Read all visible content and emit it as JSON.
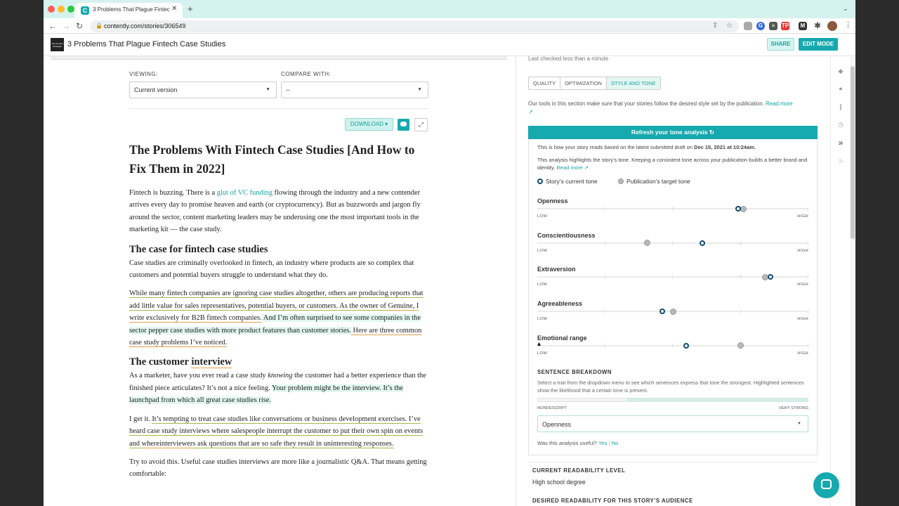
{
  "browser": {
    "tab_title": "3 Problems That Plague Fintech Case Studies",
    "tab_favicon": "C",
    "url": "contently.com/stories/306549",
    "extensions": [
      "G",
      "≡",
      "TP",
      "M"
    ]
  },
  "header": {
    "logo_text": "The Content Strategist",
    "title": "3 Problems That Plague Fintech Case Studies",
    "share_label": "SHARE",
    "edit_label": "EDIT MODE"
  },
  "compare": {
    "viewing_label": "VIEWING:",
    "viewing_value": "Current version",
    "compare_label": "COMPARE WITH:",
    "compare_value": "--",
    "download_label": "DOWNLOAD ▾"
  },
  "article": {
    "title": "The Problems With Fintech Case Studies [And How to Fix Them in 2022]",
    "p1": {
      "a": "Fintech is buzzing. There is a ",
      "link": "glut of VC funding",
      "b": " flowing through the industry and a new contender arrives every day to promise heaven and earth (or cryptocurrency). But as buzzwords and jargon fly around the sector, content marketing leaders may be underusing one the most important tools in the marketing kit — the case study."
    },
    "h2_case": "The case for fintech case studies",
    "p2": "Case studies are criminally overlooked in fintech, an industry where products are so complex that customers and potential buyers struggle to understand what they do.",
    "p3": {
      "a": "While many fintech companies are ignoring case studies altogether, others are producing reports that add little value for sales representatives, potential buyers, or customers. As the owner of ",
      "b": "Genuine, I write exclusively for B2B fintech companies.",
      "c": " And I’m often surprised to see some companies in the sector pepper case studies with more product features than customer stories.",
      "d": " Here are three common case study problems I’ve noticed."
    },
    "h2_interview_a": "The customer ",
    "h2_interview_b": "interview",
    "p4": {
      "a": "As a marketer, have you ever read a case study ",
      "em": "knowing",
      "b": " the customer had a better experience than the finished piece articulates? It’s not a nice feeling. ",
      "c": "Your problem might be the interview. It’s the launchpad from which all great case studies rise."
    },
    "p5": {
      "a": "I get it. ",
      "b": "It’s tempting to treat case studies like conversations or business development exercises. I’ve heard case study interviews where salespeople interrupt the customer to put their own spin on events and ",
      "c": "whereinterviewers",
      "d": " ask questions that are so safe they result in uninteresting responses."
    },
    "p6": "Try to avoid this. Useful case studies interviews are more like a journalistic Q&A. That means getting comfortable:"
  },
  "panel": {
    "last_checked": "Last checked less than a minute",
    "tabs": [
      "QUALITY",
      "OPTIMIZATION",
      "STYLE AND TONE"
    ],
    "active_tab": "STYLE AND TONE",
    "intro": "Our tools in this section make sure that your stories follow the desired style set by the publication.",
    "read_more": "Read more",
    "refresh_label": "Refresh your tone analysis ↻",
    "reads_a": "This is how your story reads based on the latest submitted draft on ",
    "reads_date": "Dec 15, 2021 at 10:24am.",
    "highlights": "This analysis highlights the story’s tone. Keeping a consistent tone across your publication builds a better brand and identity.",
    "legend_current": "Story’s current tone",
    "legend_target": "Publication’s target tone",
    "low": "LOW",
    "high": "HIGH",
    "traits": [
      {
        "name": "Openness",
        "current": 0.74,
        "target": 0.76
      },
      {
        "name": "Conscientiousness",
        "current": 0.61,
        "target": 0.405
      },
      {
        "name": "Extraversion",
        "current": 0.86,
        "target": 0.84
      },
      {
        "name": "Agreeableness",
        "current": 0.46,
        "target": 0.5
      },
      {
        "name": "Emotional range",
        "current": 0.55,
        "target": 0.75
      }
    ],
    "sb_title": "SENTENCE BREAKDOWN",
    "sb_desc": "Select a trait from the dropdown menu to see which sentences express that tone the strongest. Highlighted sentences show the likelihood that a certain tone is present.",
    "sb_low": "NONDESCRIPT",
    "sb_high": "VERY STRONG",
    "sb_selected": "Openness",
    "useful_q": "Was this analysis useful?",
    "yes": "Yes",
    "no": "No",
    "readability_label": "CURRENT READABILITY LEVEL",
    "readability_value": "High school degree",
    "desired_label": "DESIRED READABILITY FOR THIS STORY’S AUDIENCE"
  },
  "colors": {
    "accent": "#16a9ae",
    "current_dot": "#0d4a6e",
    "target_dot": "#b8b8b8"
  },
  "rail_icons": [
    "tag-icon",
    "comments-icon",
    "attachment-icon",
    "history-icon",
    "expand-icon",
    "lightbulb-icon"
  ]
}
